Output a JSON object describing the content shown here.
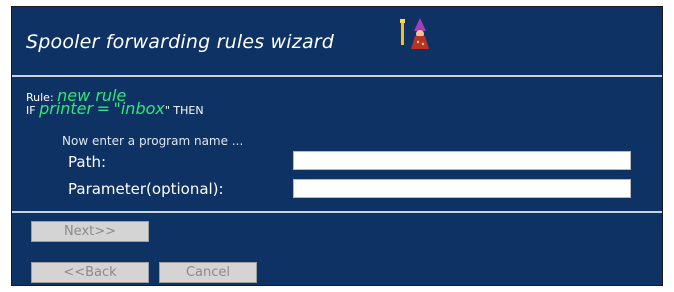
{
  "window": {
    "title": "Spooler forwarding rules wizard"
  },
  "rule": {
    "label": "Rule:",
    "name": "new rule",
    "if_keyword": "IF",
    "condition_left": "printer",
    "condition_op": "=",
    "condition_value": "\"inbox",
    "closing_quote": "\"",
    "then_keyword": "THEN"
  },
  "form": {
    "prompt": "Now enter a program name ...",
    "path_label": "Path:",
    "path_value": "",
    "parameter_label": "Parameter(optional):",
    "parameter_value": ""
  },
  "buttons": {
    "next": "Next>>",
    "back": "<<Back",
    "cancel": "Cancel"
  },
  "colors": {
    "window_bg": "#0e3263",
    "highlight_green": "#2ee87a",
    "text": "#ffffff",
    "button_bg": "#d4d4d4"
  },
  "icons": {
    "wizard": "wizard-mascot-icon"
  }
}
